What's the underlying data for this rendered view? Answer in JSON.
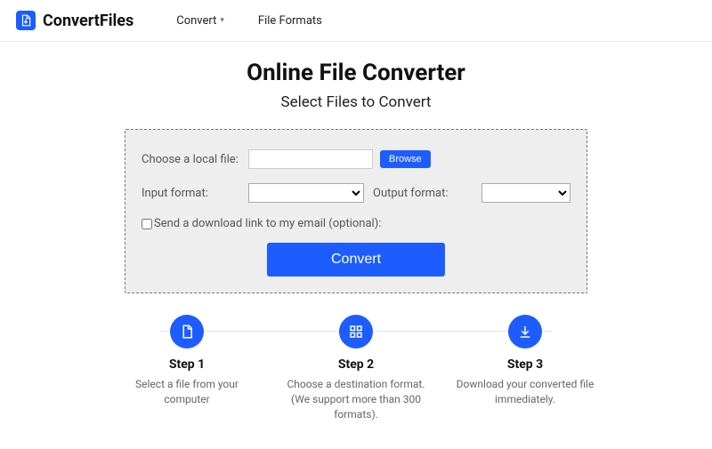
{
  "header": {
    "brand": "ConvertFiles",
    "nav": {
      "convert": "Convert",
      "formats": "File Formats"
    }
  },
  "hero": {
    "title": "Online File Converter",
    "subtitle": "Select Files to Convert"
  },
  "form": {
    "choose_label": "Choose a local file:",
    "browse": "Browse",
    "input_format_label": "Input format:",
    "output_format_label": "Output format:",
    "email_checkbox_label": "Send a download link to my email (optional):",
    "convert": "Convert"
  },
  "steps": [
    {
      "title": "Step 1",
      "desc": "Select a file from your computer"
    },
    {
      "title": "Step 2",
      "desc": "Choose a destination format. (We support more than 300 formats)."
    },
    {
      "title": "Step 3",
      "desc": "Download your converted file immediately."
    }
  ]
}
